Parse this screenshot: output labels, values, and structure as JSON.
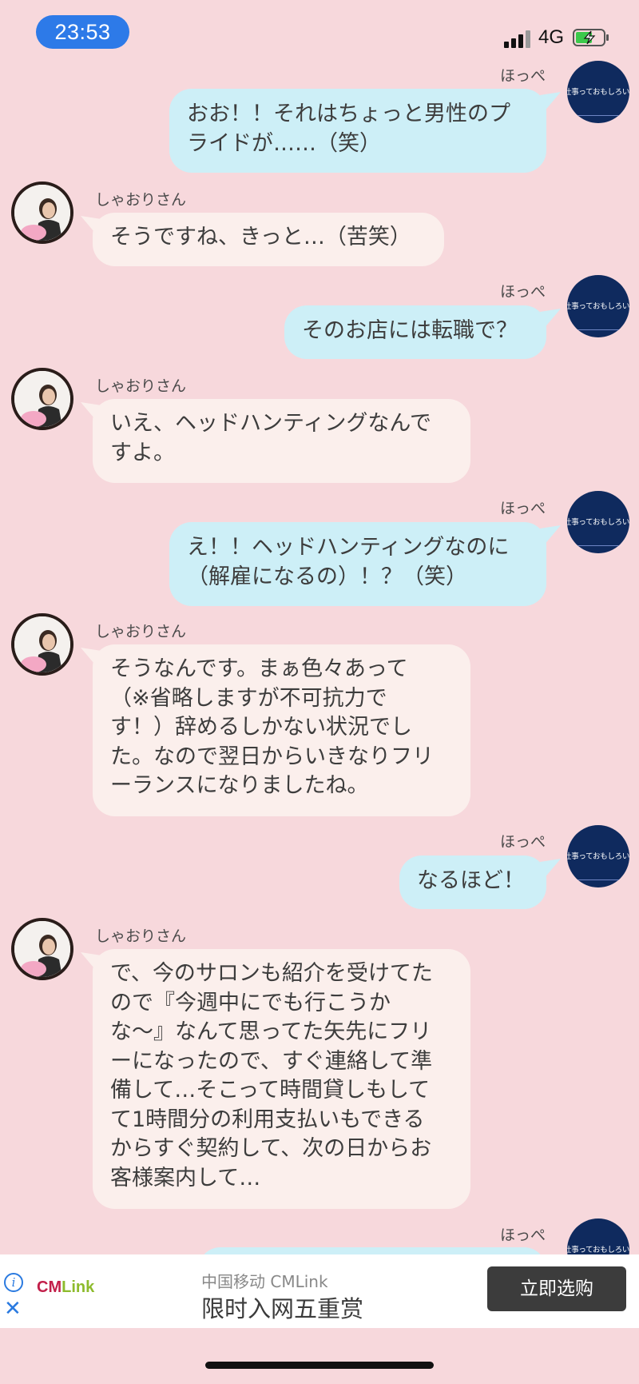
{
  "status_bar": {
    "time": "23:53",
    "network": "4G"
  },
  "avatar_text": "仕事っておもしろいや",
  "messages": [
    {
      "sender": "ほっぺ",
      "side": "me",
      "lines": [
        "おお！！それはちょっと男性のプ",
        "ライドが……（笑）"
      ]
    },
    {
      "sender": "しゃおりさん",
      "side": "her",
      "lines": [
        "そうですね、きっと…（苦笑）"
      ]
    },
    {
      "sender": "ほっぺ",
      "side": "me",
      "lines": [
        "そのお店には転職で？"
      ]
    },
    {
      "sender": "しゃおりさん",
      "side": "her",
      "lines": [
        "いえ、ヘッドハンティングなんで",
        "すよ。"
      ]
    },
    {
      "sender": "ほっぺ",
      "side": "me",
      "lines": [
        "え！！ヘッドハンティングなのに",
        "（解雇になるの）！？（笑）"
      ]
    },
    {
      "sender": "しゃおりさん",
      "side": "her",
      "lines": [
        "そうなんです。まぁ色々あって",
        "（※省略しますが不可抗力で",
        "す！）辞めるしかない状況でし",
        "た。なので翌日からいきなりフリ",
        "ーランスになりましたね。"
      ]
    },
    {
      "sender": "ほっぺ",
      "side": "me",
      "lines": [
        "なるほど！"
      ]
    },
    {
      "sender": "しゃおりさん",
      "side": "her",
      "lines": [
        "で、今のサロンも紹介を受けてた",
        "ので『今週中にでも行こうか",
        "な〜』なんて思ってた矢先にフリ",
        "ーになったので、すぐ連絡して準",
        "備して…そこって時間貸しもして",
        "て1時間分の利用支払いもできる",
        "からすぐ契約して、次の日からお",
        "客様案内して…"
      ]
    },
    {
      "sender": "ほっぺ",
      "side": "me",
      "lines": []
    }
  ],
  "ad": {
    "title": "中国移动 CMLink",
    "text": "限时入网五重赏",
    "button": "立即选购",
    "logo_cm": "CM",
    "logo_link": "Link"
  },
  "colors": {
    "background": "#f7d8dc",
    "my_bubble": "#cdeff7",
    "her_bubble": "#fbefec",
    "time_pill": "#2d7ae8",
    "avatar_me": "#0f2a5e"
  }
}
